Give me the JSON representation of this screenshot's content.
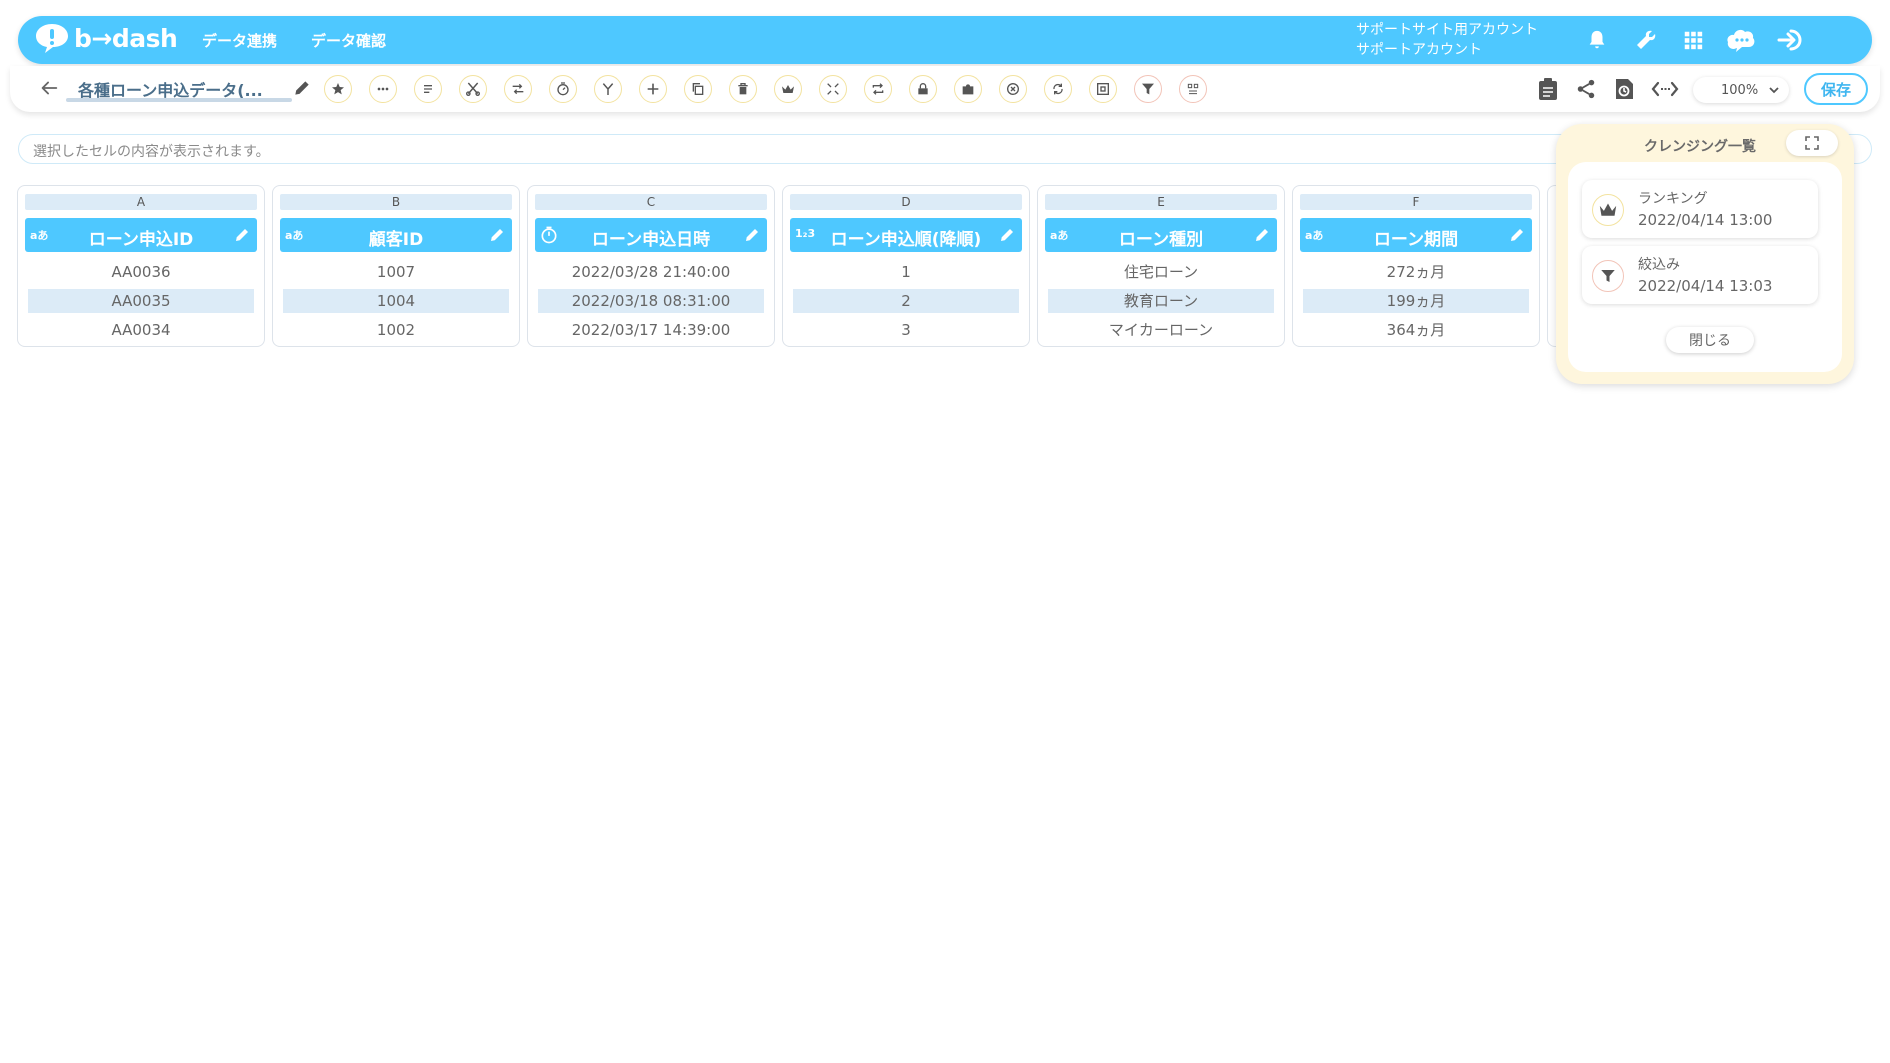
{
  "app": {
    "logo_text": "b→dash",
    "logo_icon": "speech-bubble-logo"
  },
  "header": {
    "nav": [
      "データ連携",
      "データ確認"
    ],
    "account_line1": "サポートサイト用アカウント",
    "account_line2": "サポートアカウント",
    "icons": [
      "bell-icon",
      "wrench-icon",
      "grid-icon",
      "cloud-chat-icon",
      "logout-icon"
    ]
  },
  "toolbar": {
    "title": "各種ローン申込データ(...",
    "tools": [
      "star",
      "more",
      "list",
      "cut",
      "swap",
      "timer",
      "branch",
      "plus",
      "copy",
      "trash",
      "crown",
      "compress",
      "loop",
      "lock",
      "puzzle",
      "cancel",
      "replace",
      "frame",
      "filter",
      "dedup"
    ],
    "zoom": "100%",
    "save_label": "保存"
  },
  "cellbar": {
    "placeholder": "選択したセルの内容が表示されます。"
  },
  "table": {
    "columns": [
      {
        "letter": "A",
        "type": "aあ",
        "name": "ローン申込ID",
        "cells": [
          "AA0036",
          "AA0035",
          "AA0034"
        ]
      },
      {
        "letter": "B",
        "type": "aあ",
        "name": "顧客ID",
        "cells": [
          "1007",
          "1004",
          "1002"
        ]
      },
      {
        "letter": "C",
        "type": "clock",
        "name": "ローン申込日時",
        "cells": [
          "2022/03/28 21:40:00",
          "2022/03/18 08:31:00",
          "2022/03/17 14:39:00"
        ]
      },
      {
        "letter": "D",
        "type": "1₂3",
        "name": "ローン申込順(降順)",
        "cells": [
          "1",
          "2",
          "3"
        ]
      },
      {
        "letter": "E",
        "type": "aあ",
        "name": "ローン種別",
        "cells": [
          "住宅ローン",
          "教育ローン",
          "マイカーローン"
        ]
      },
      {
        "letter": "F",
        "type": "aあ",
        "name": "ローン期間",
        "cells": [
          "272ヵ月",
          "199ヵ月",
          "364ヵ月"
        ]
      }
    ]
  },
  "cleansing": {
    "title": "クレンジング一覧",
    "items": [
      {
        "name": "ランキング",
        "date": "2022/04/14 13:00",
        "icon": "crown-icon"
      },
      {
        "name": "絞込み",
        "date": "2022/04/14 13:03",
        "icon": "filter-icon"
      }
    ],
    "close_label": "閉じる"
  },
  "colors": {
    "accent": "#4ec8ff",
    "panel": "#fef6dd",
    "row_alt": "#dcebf7"
  }
}
